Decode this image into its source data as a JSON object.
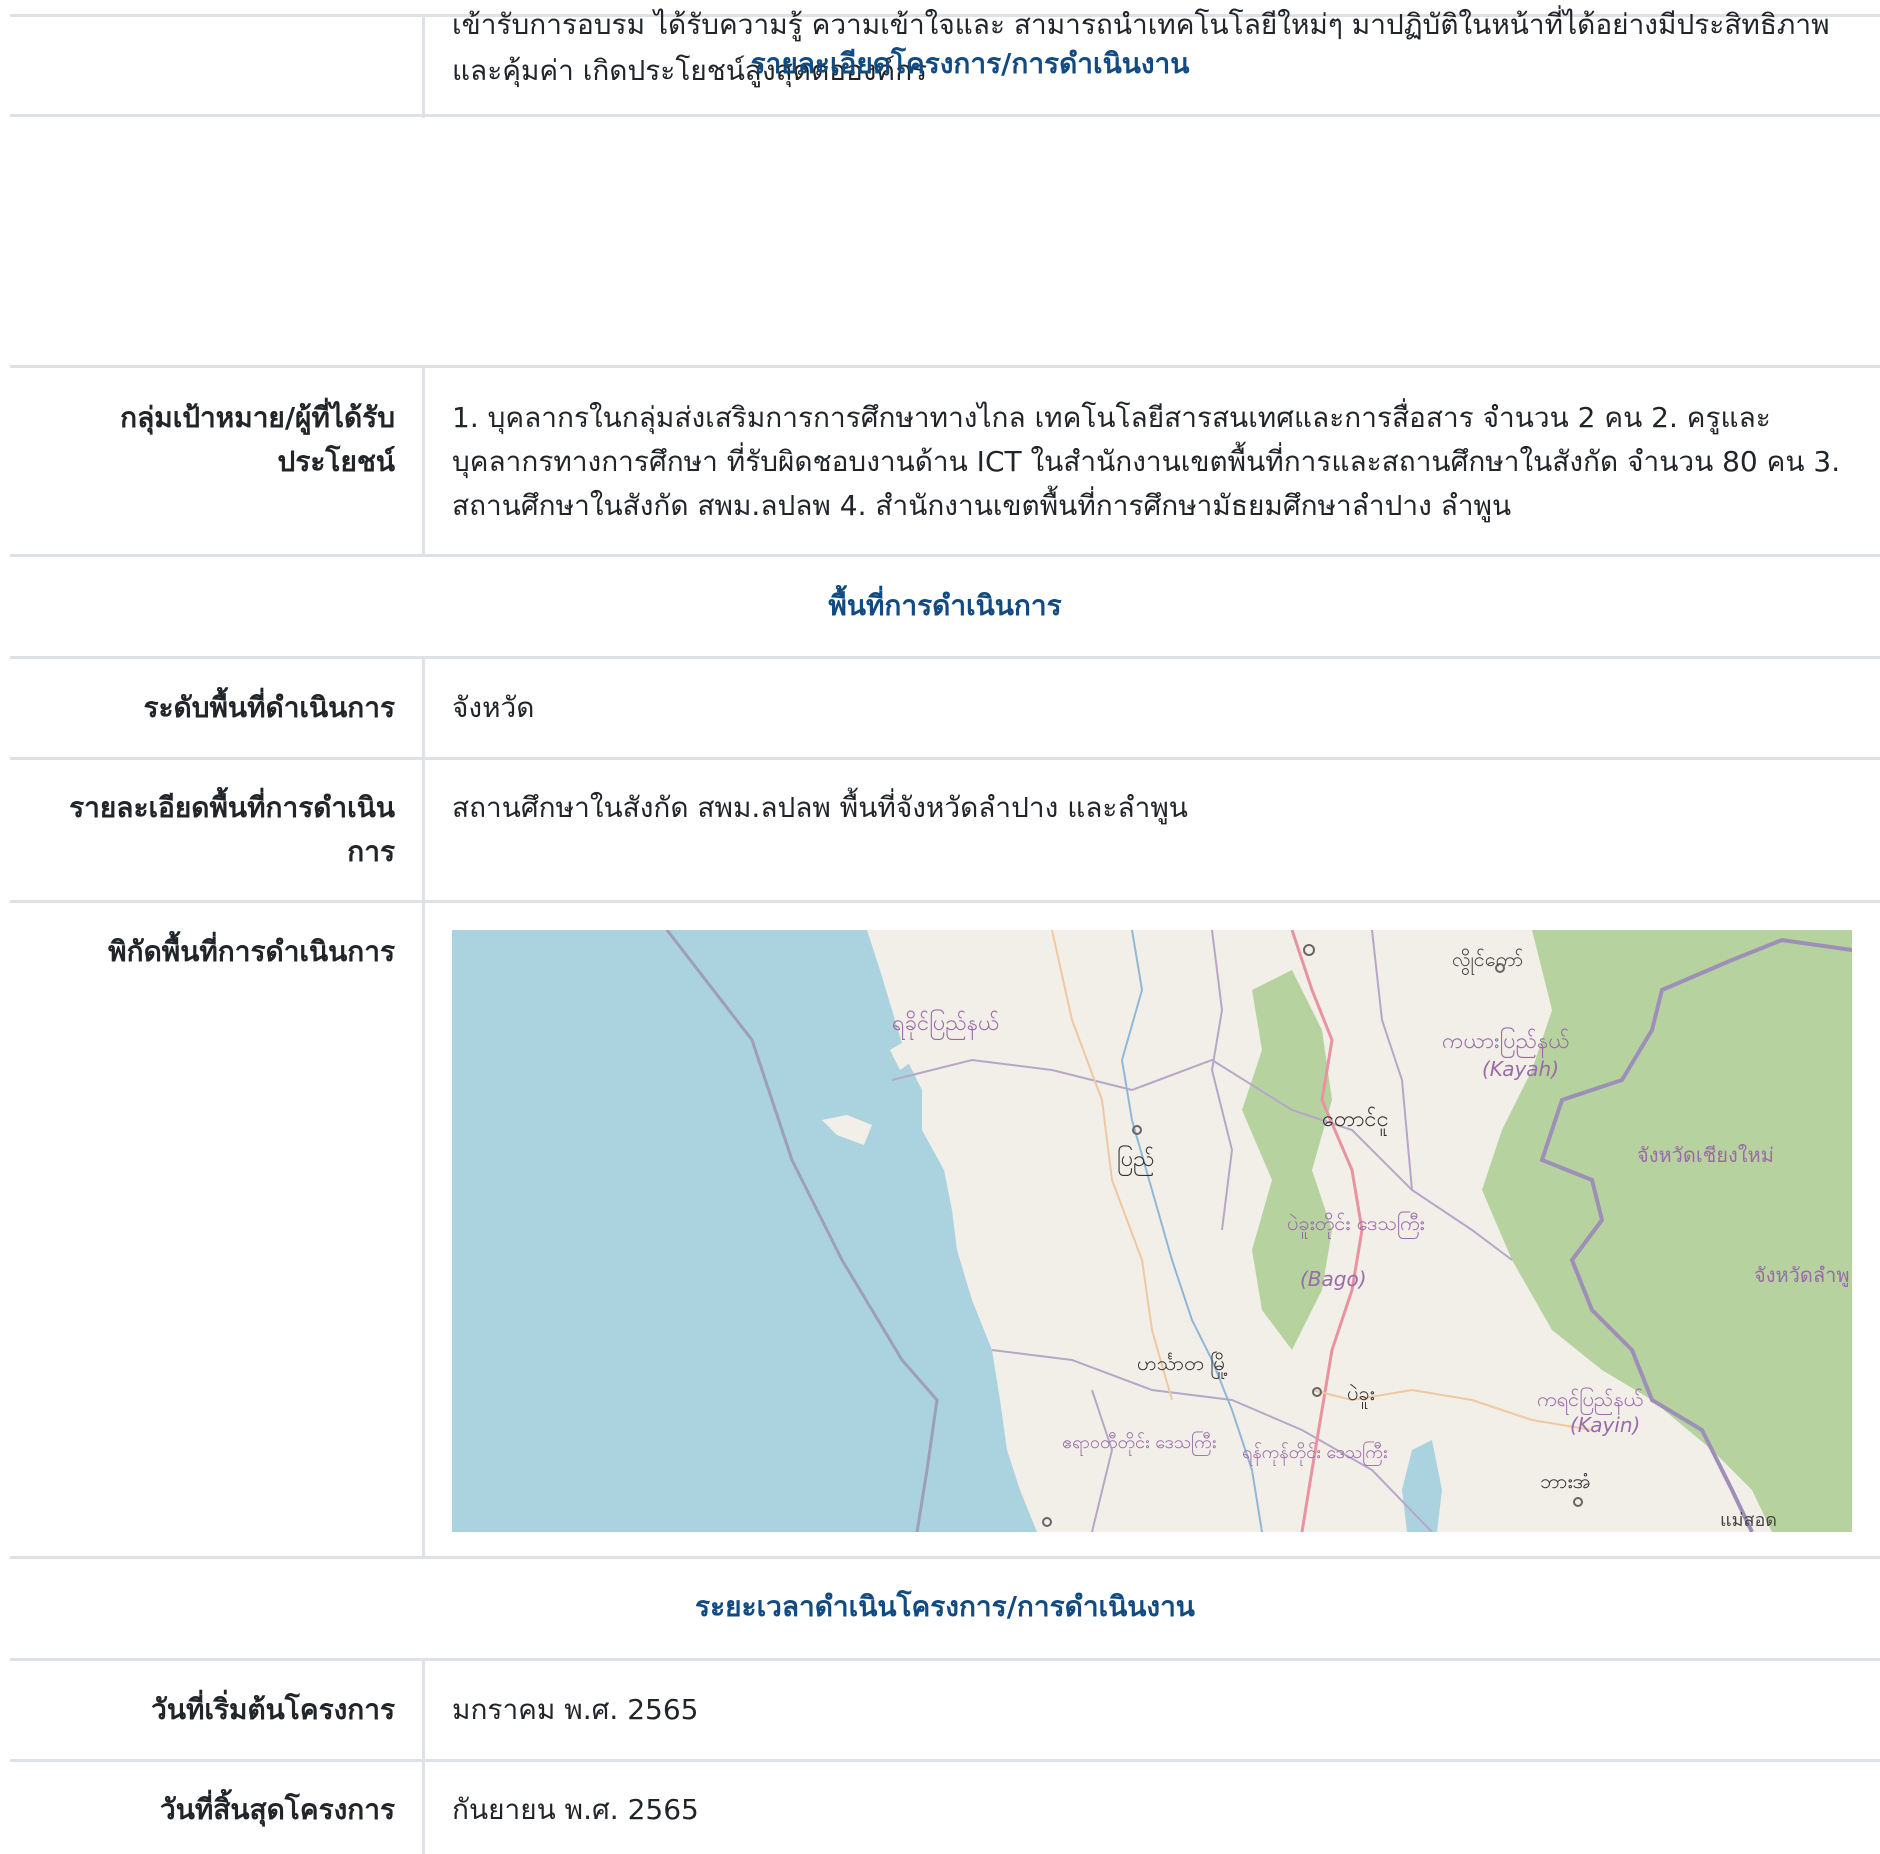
{
  "top_partial": {
    "value_line1": "เข้ารับการอบรม ได้รับความรู้ ความเข้าใจและ สามารถนำเทคโนโลยีใหม่ๆ มาปฏิบัติในหน้าที่ได้อย่างมีประสิทธิภาพ",
    "value_line2": "และคุ้มค่า เกิดประโยชน์สูงสุดต่อองค์กร",
    "overlay_heading": "รายละเอียดโครงการ/การดำเนินงาน"
  },
  "target_group": {
    "label": "กลุ่มเป้าหมาย/ผู้ที่ได้รับประโยชน์",
    "value": "1. บุคลากรในกลุ่มส่งเสริมการการศึกษาทางไกล เทคโนโลยีสารสนเทศและการสื่อสาร จำนวน 2 คน 2. ครูและบุคลากรทางการศึกษา ที่รับผิดชอบงานด้าน ICT ในสำนักงานเขตพื้นที่การและสถานศึกษาในสังกัด จำนวน 80 คน 3. สถานศึกษาในสังกัด สพม.ลปลพ 4. สำนักงานเขตพื้นที่การศึกษามัธยมศึกษาลำปาง ลำพูน"
  },
  "area_section": {
    "title": "พื้นที่การดำเนินการ"
  },
  "area_level": {
    "label": "ระดับพื้นที่ดำเนินการ",
    "value": "จังหวัด"
  },
  "area_detail": {
    "label": "รายละเอียดพื้นที่การดำเนินการ",
    "value": "สถานศึกษาในสังกัด สพม.ลปลพ พื้นที่จังหวัดลำปาง และลำพูน"
  },
  "area_coords": {
    "label": "พิกัดพื้นที่การดำเนินการ",
    "map_labels": {
      "rakhine": "ရခိုင်ပြည်နယ်",
      "kayah_mm": "ကယားပြည်နယ်",
      "kayah_en": "(Kayah)",
      "taungoo": "တောင်ငူ",
      "pyay": "ပြည်",
      "bago_mm": "ပဲခူးတိုင်း ဒေသကြီး",
      "bago_en": "(Bago)",
      "hinthada": "ဟင်္သာတ မြို့",
      "bago_city": "ပဲခူး",
      "kayin_mm": "ကရင်ပြည်နယ်",
      "kayin_en": "(Kayin)",
      "ayeyarwady": "ဧရာဝတီတိုင်း ဒေသကြီး",
      "yangon": "ရန်ကုန်တိုင်း ဒေသကြီး",
      "hpa_an": "ဘားအံ",
      "chiang_mai": "จังหวัดเชียงใหม่",
      "lamphun": "จังหวัดลำพู",
      "mae_sot": "แม่สอด",
      "loikaw": "လွိုင်ကော်"
    },
    "colors": {
      "sea": "#aad3df",
      "land": "#f2efe9",
      "forest": "#b5d29f",
      "border": "#9e9eb8",
      "road": "#e892a2"
    }
  },
  "duration_section": {
    "title": "ระยะเวลาดำเนินโครงการ/การดำเนินงาน"
  },
  "start_date": {
    "label": "วันที่เริ่มต้นโครงการ",
    "value": "มกราคม พ.ศ. 2565"
  },
  "end_date": {
    "label": "วันที่สิ้นสุดโครงการ",
    "value": "กันยายน พ.ศ. 2565"
  }
}
